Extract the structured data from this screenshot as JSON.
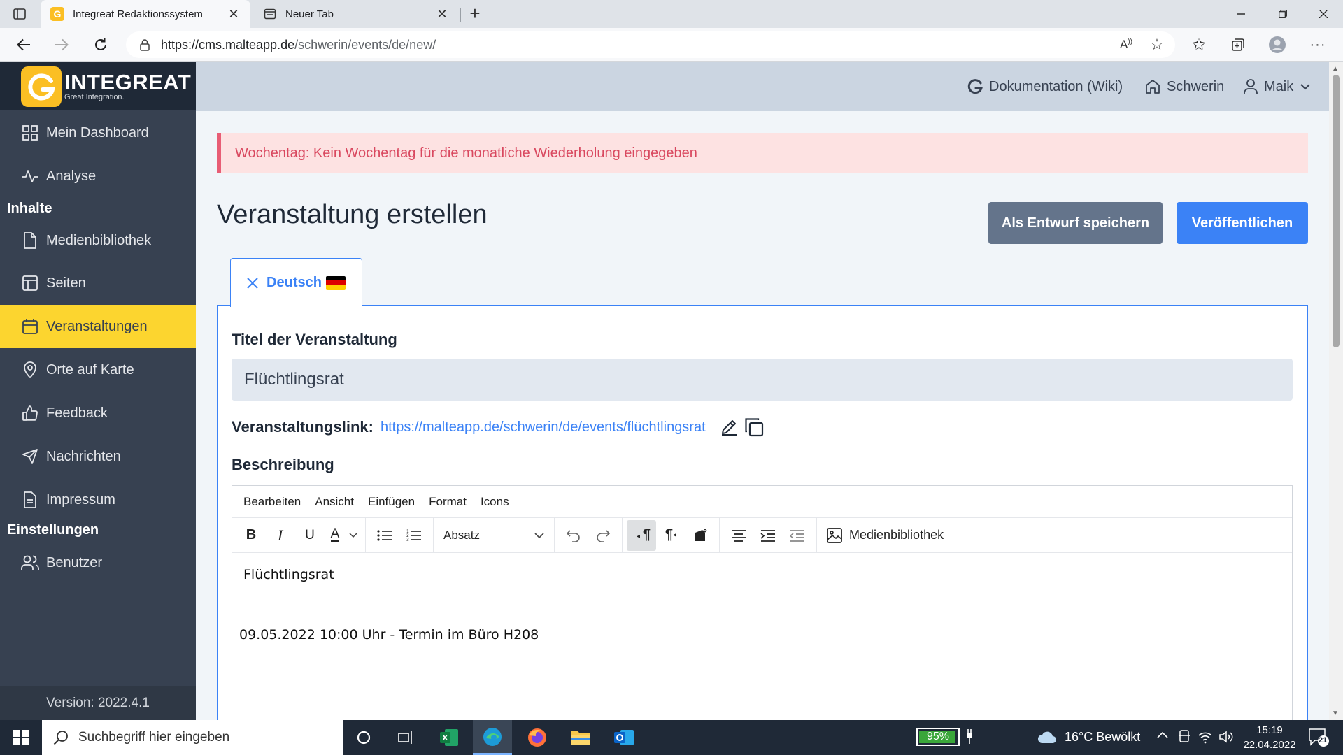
{
  "browser": {
    "active_tab": "Integreat Redaktionssystem",
    "inactive_tab": "Neuer Tab",
    "url_host": "https://cms.malteapp.de",
    "url_path": "/schwerin/events/de/new/"
  },
  "sidebar": {
    "logo_title": "INTEGREAT",
    "logo_subtitle": "Great Integration.",
    "items": [
      {
        "label": "Mein Dashboard",
        "icon": "dashboard-icon"
      },
      {
        "label": "Analyse",
        "icon": "activity-icon"
      },
      {
        "label": "Medienbibliothek",
        "icon": "file-icon"
      },
      {
        "label": "Seiten",
        "icon": "layout-icon"
      },
      {
        "label": "Veranstaltungen",
        "icon": "calendar-icon"
      },
      {
        "label": "Orte auf Karte",
        "icon": "map-pin-icon"
      },
      {
        "label": "Feedback",
        "icon": "thumbs-up-icon"
      },
      {
        "label": "Nachrichten",
        "icon": "send-icon"
      },
      {
        "label": "Impressum",
        "icon": "file-text-icon"
      },
      {
        "label": "Benutzer",
        "icon": "users-icon"
      }
    ],
    "section_content": "Inhalte",
    "section_settings": "Einstellungen",
    "version": "Version: 2022.4.1"
  },
  "header": {
    "docs": "Dokumentation (Wiki)",
    "region": "Schwerin",
    "user": "Maik"
  },
  "alert": {
    "message": "Wochentag: Kein Wochentag für die monatliche Wiederholung eingegeben"
  },
  "page": {
    "title": "Veranstaltung erstellen",
    "save_draft": "Als Entwurf speichern",
    "publish": "Veröffentlichen",
    "language_tab": "Deutsch"
  },
  "form": {
    "title_label": "Titel der Veranstaltung",
    "title_value": "Flüchtlingsrat",
    "link_label": "Veranstaltungslink:",
    "link_value": "https://malteapp.de/schwerin/de/events/flüchtlingsrat",
    "description_label": "Beschreibung"
  },
  "editor": {
    "menu": [
      "Bearbeiten",
      "Ansicht",
      "Einfügen",
      "Format",
      "Icons"
    ],
    "block_format": "Absatz",
    "media_button": "Medienbibliothek",
    "content_line1": "Flüchtlingsrat",
    "content_line2": "09.05.2022 10:00 Uhr - Termin im Büro H208"
  },
  "taskbar": {
    "search_placeholder": "Suchbegriff hier eingeben",
    "battery": "95%",
    "weather": "16°C  Bewölkt",
    "time": "15:19",
    "date": "22.04.2022",
    "notifications": "21"
  },
  "colors": {
    "sidebar_bg": "#374151",
    "active_yellow": "#fcd52f",
    "primary_blue": "#3b82f6",
    "alert_red": "#d9485f"
  }
}
